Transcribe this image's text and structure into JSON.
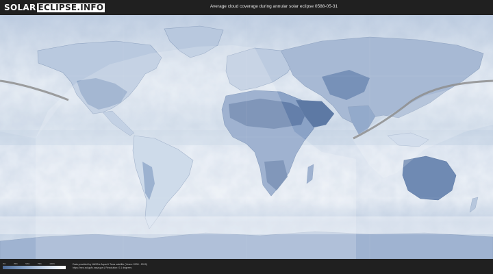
{
  "header": {
    "logo_part1": "SOLAR",
    "logo_part2": "ECLIPSE.INFO",
    "title": "Average cloud coverage during annular solar eclipse 0588-05-31"
  },
  "legend": {
    "ticks": [
      "0%",
      "25%",
      "50%",
      "75%",
      "100%"
    ],
    "low_color": "#4d6a97",
    "high_color": "#ffffff"
  },
  "footer": {
    "source_line1": "Data provided by NASA's Aqua & Terra satellite (Years: 2000 - 2019)",
    "source_line2": "https://neo.sci.gsfc.nasa.gov | Resolution: 0.1 degrees"
  },
  "map": {
    "projection": "equirectangular",
    "colors": {
      "ocean_cloud": "#e4ebf4",
      "land_clear": "#6d87b2",
      "eclipse_path": "#8e8e8e"
    }
  }
}
